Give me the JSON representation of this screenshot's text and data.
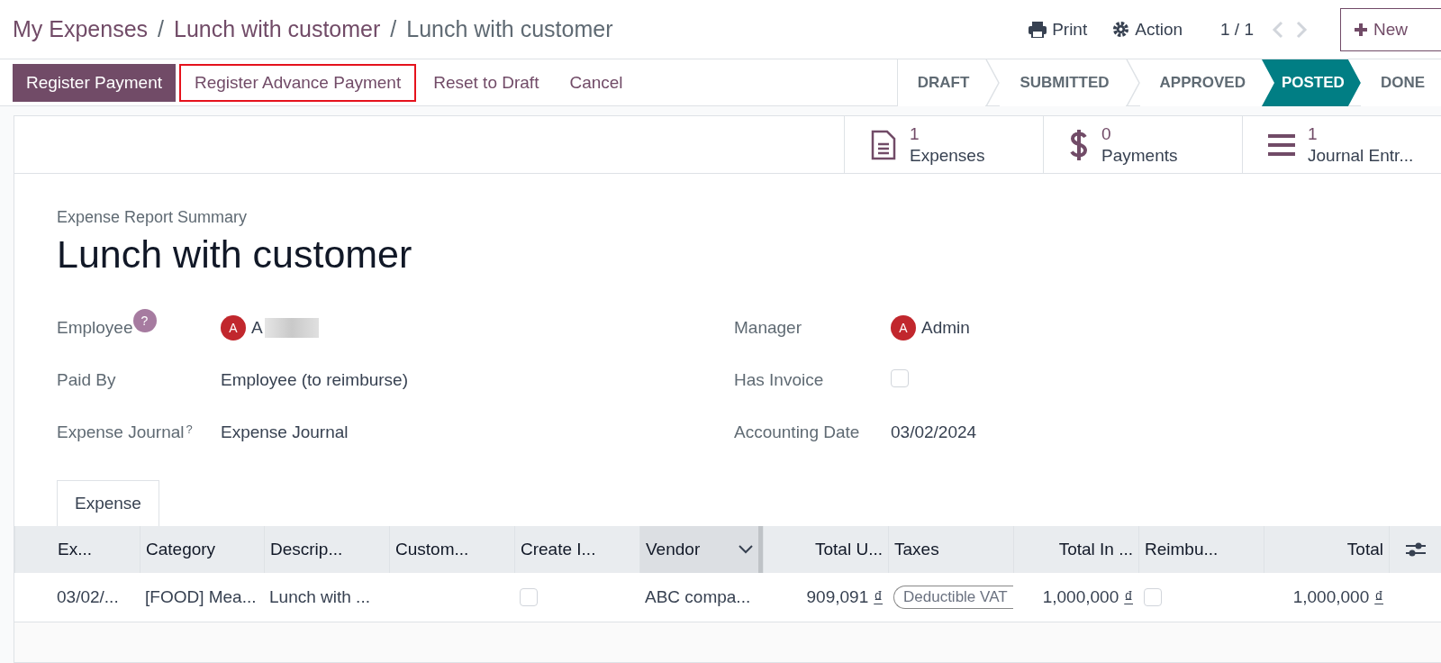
{
  "breadcrumbs": [
    {
      "label": "My Expenses"
    },
    {
      "label": "Lunch with customer"
    },
    {
      "label": "Lunch with customer"
    }
  ],
  "separator": "/",
  "toolbar": {
    "print": "Print",
    "action": "Action",
    "pager": "1 / 1",
    "new": "New"
  },
  "action_buttons": [
    {
      "label": "Register Payment",
      "kind": "primary"
    },
    {
      "label": "Register Advance Payment",
      "kind": "highlighted"
    },
    {
      "label": "Reset to Draft",
      "kind": "plain"
    },
    {
      "label": "Cancel",
      "kind": "plain"
    }
  ],
  "status_steps": [
    {
      "label": "DRAFT",
      "selected": false
    },
    {
      "label": "SUBMITTED",
      "selected": false
    },
    {
      "label": "APPROVED",
      "selected": false
    },
    {
      "label": "POSTED",
      "selected": true
    },
    {
      "label": "DONE",
      "selected": false
    }
  ],
  "stat_buttons": [
    {
      "count": "1",
      "label": "Expenses",
      "kind": "file"
    },
    {
      "count": "0",
      "label": "Payments",
      "kind": "dollar"
    },
    {
      "count": "1",
      "label": "Journal Entr...",
      "kind": "list"
    }
  ],
  "form": {
    "subtitle": "Expense Report Summary",
    "title": "Lunch with customer",
    "left_fields": [
      {
        "label": "Employee",
        "help": {
          "text": "?",
          "kind": "badge"
        },
        "kind": "avatar",
        "avatar": "A",
        "value": "A",
        "redacted": true
      },
      {
        "label": "Paid By",
        "kind": "text",
        "value": "Employee (to reimburse)"
      },
      {
        "label": "Expense Journal",
        "help": {
          "text": "?",
          "kind": "sup"
        },
        "kind": "text",
        "value": "Expense Journal"
      }
    ],
    "right_fields": [
      {
        "label": "Manager",
        "kind": "avatar",
        "avatar": "A",
        "value": "Admin",
        "redacted": false
      },
      {
        "label": "Has Invoice",
        "kind": "checkbox",
        "checked": false
      },
      {
        "label": "Accounting Date",
        "kind": "text",
        "value": "03/02/2024"
      }
    ]
  },
  "tabs": [
    {
      "label": "Expense",
      "selected": true
    }
  ],
  "table": {
    "columns": [
      {
        "label": "Ex...",
        "kind": "text",
        "active": false
      },
      {
        "label": "Category",
        "kind": "text",
        "active": false
      },
      {
        "label": "Descrip...",
        "kind": "text",
        "active": false
      },
      {
        "label": "Custom...",
        "kind": "text",
        "active": false
      },
      {
        "label": "Create I...",
        "kind": "text",
        "active": false
      },
      {
        "label": "Vendor",
        "kind": "text",
        "active": true
      },
      {
        "label": "Total U...",
        "kind": "number",
        "active": false
      },
      {
        "label": "Taxes",
        "kind": "text",
        "active": false
      },
      {
        "label": "Total In ...",
        "kind": "number",
        "active": false
      },
      {
        "label": "Reimbu...",
        "kind": "text",
        "active": false
      },
      {
        "label": "Total",
        "kind": "number",
        "active": false
      }
    ],
    "rows": [
      {
        "cells": [
          {
            "kind": "text",
            "text": "03/02/..."
          },
          {
            "kind": "text",
            "text": "[FOOD] Mea..."
          },
          {
            "kind": "text",
            "text": "Lunch with ..."
          },
          {
            "kind": "empty"
          },
          {
            "kind": "checkbox",
            "checked": false
          },
          {
            "kind": "text",
            "text": "ABC compa..."
          },
          {
            "kind": "money",
            "text": "909,091",
            "currency": "₫"
          },
          {
            "kind": "tag",
            "text": "Deductible VAT"
          },
          {
            "kind": "money",
            "text": "1,000,000",
            "currency": "₫"
          },
          {
            "kind": "checkbox",
            "checked": false
          },
          {
            "kind": "money",
            "text": "1,000,000",
            "currency": "₫"
          }
        ]
      }
    ]
  }
}
